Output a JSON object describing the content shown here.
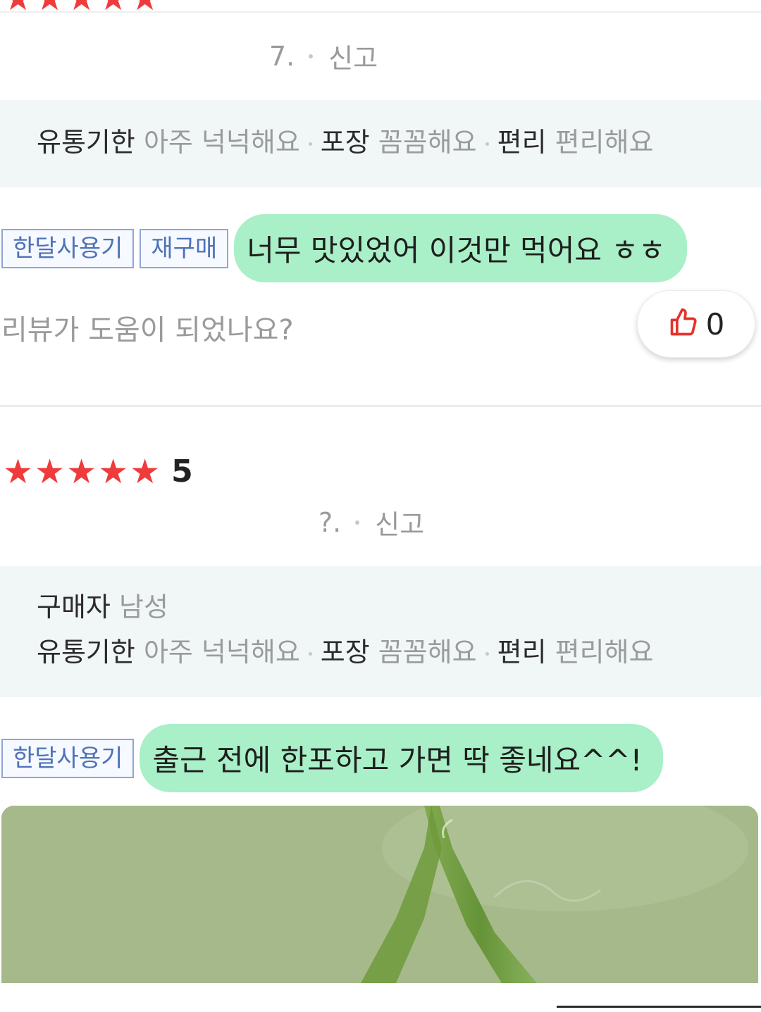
{
  "review1": {
    "meta_tail": "7.",
    "report_label": "신고",
    "attributes": [
      {
        "key": "유통기한",
        "value": "아주 넉넉해요"
      },
      {
        "key": "포장",
        "value": "꼼꼼해요"
      },
      {
        "key": "편리",
        "value": "편리해요"
      }
    ],
    "tags": [
      "한달사용기",
      "재구매"
    ],
    "text": "너무 맛있었어 이것만 먹어요 ㅎㅎ",
    "helpful_question": "리뷰가 도움이 되었나요?",
    "like_count": "0"
  },
  "review2": {
    "rating": "5",
    "star_count": 5,
    "meta_tail": "?.",
    "report_label": "신고",
    "buyer": {
      "key": "구매자",
      "value": "남성"
    },
    "attributes": [
      {
        "key": "유통기한",
        "value": "아주 넉넉해요"
      },
      {
        "key": "포장",
        "value": "꼼꼼해요"
      },
      {
        "key": "편리",
        "value": "편리해요"
      }
    ],
    "tags": [
      "한달사용기"
    ],
    "text": "출근 전에 한포하고 가면 딱 좋네요^^!"
  },
  "colors": {
    "star": "#ef3b3b",
    "highlight": "#a9efc7",
    "tag_text": "#4e72b8",
    "like_icon": "#e5322d"
  },
  "icons": [
    "star-icon",
    "thumbs-up-icon"
  ]
}
